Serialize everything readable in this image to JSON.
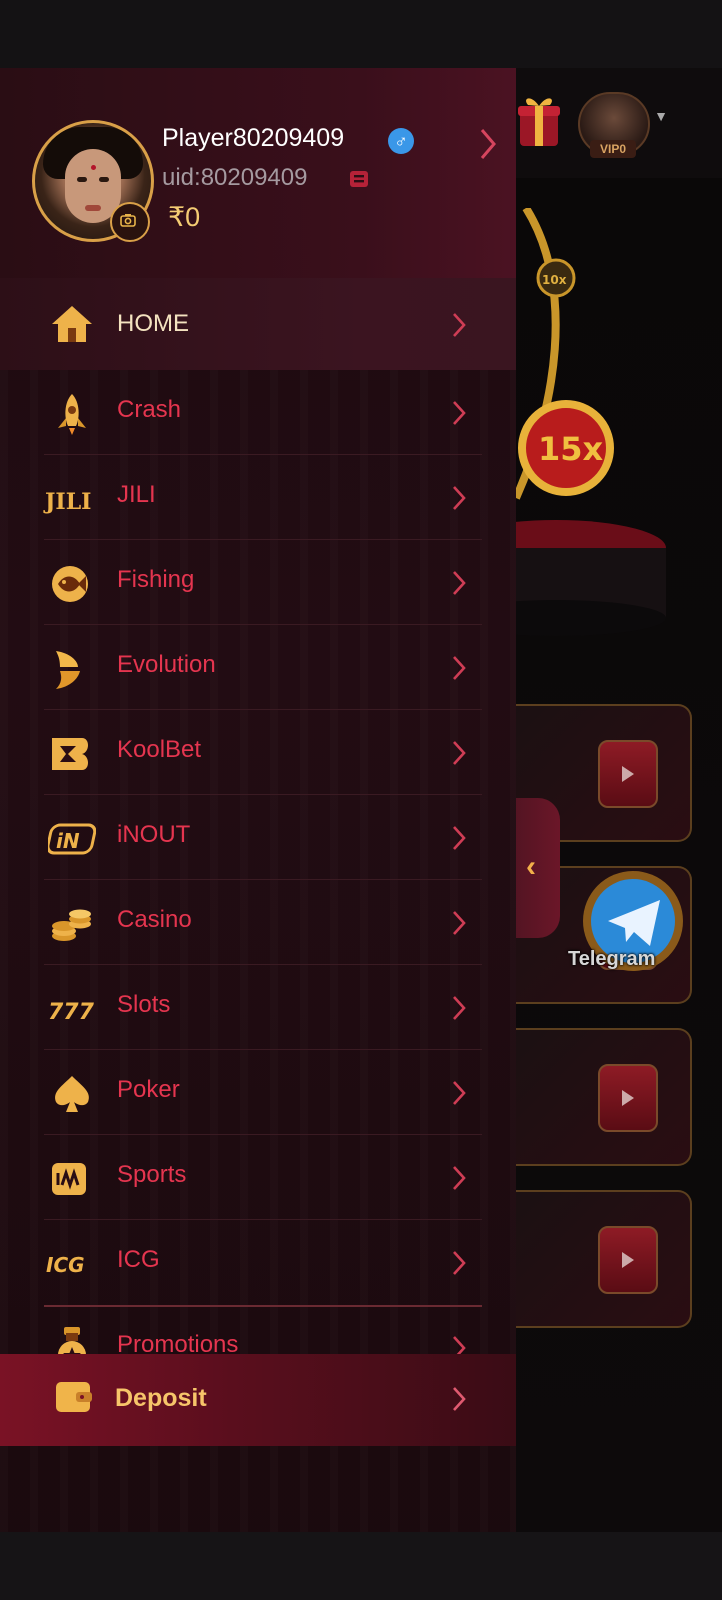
{
  "profile": {
    "username": "Player80209409",
    "gender_symbol": "♂",
    "uid": "uid:80209409",
    "balance": "₹0"
  },
  "menu": {
    "home": "HOME",
    "crash": "Crash",
    "jili": "JILI",
    "fishing": "Fishing",
    "evolution": "Evolution",
    "koolbet": "KoolBet",
    "inout": "iNOUT",
    "casino": "Casino",
    "slots": "Slots",
    "poker": "Poker",
    "sports": "Sports",
    "icg": "ICG",
    "promotions": "Promotions",
    "deposit": "Deposit"
  },
  "background": {
    "vip_label": "VIP0",
    "telegram_label": "Telegram"
  },
  "icons": {
    "jili_text": "JILI",
    "inout_text": "iN",
    "icg_text": "ICG",
    "slots_text": "777"
  },
  "colors": {
    "accent_gold": "#f4cc73",
    "menu_text": "#e5354f",
    "drawer_bg": "#230c13"
  }
}
